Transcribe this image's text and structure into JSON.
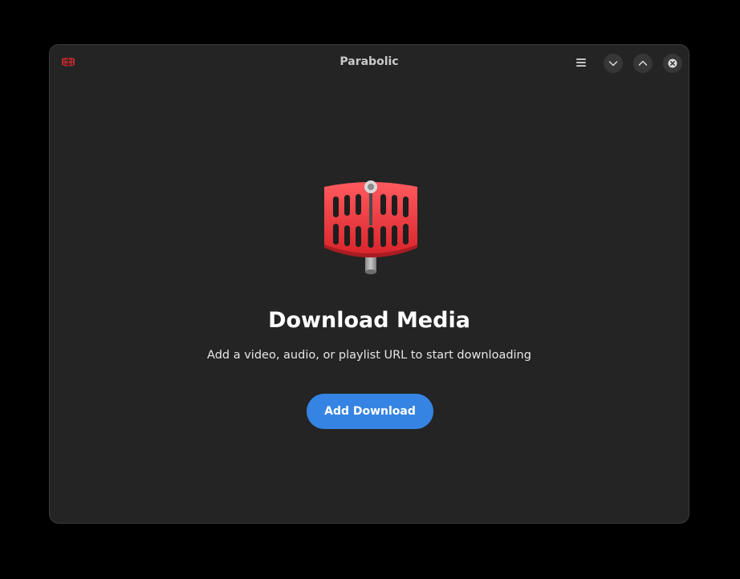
{
  "window": {
    "title": "Parabolic",
    "app_icon": "parabolic-dish-icon",
    "controls": {
      "menu_icon": "hamburger-menu-icon",
      "minimize_icon": "chevron-down-icon",
      "maximize_icon": "chevron-up-icon",
      "close_icon": "close-icon"
    }
  },
  "main": {
    "icon": "parabolic-dish-icon",
    "title": "Download Media",
    "description": "Add a video, audio, or playlist URL to start downloading",
    "add_button_label": "Add Download"
  },
  "colors": {
    "accent": "#3584e4",
    "brand_red": "#e5393e",
    "window_bg": "#242424",
    "page_bg": "#000000"
  }
}
